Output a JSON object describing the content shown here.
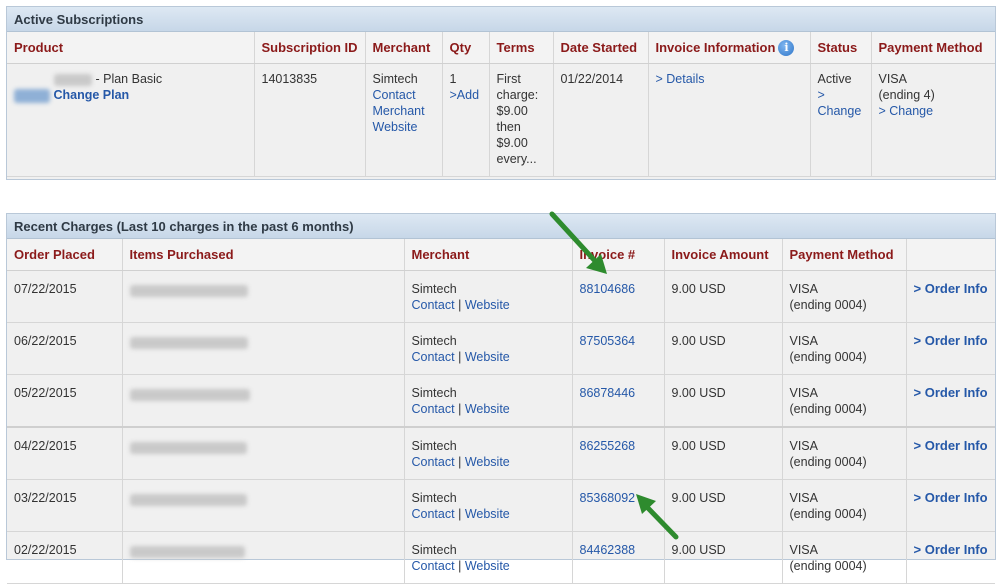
{
  "active": {
    "title": "Active Subscriptions",
    "columns": [
      "Product",
      "Subscription ID",
      "Merchant",
      "Qty",
      "Terms",
      "Date Started",
      "Invoice Information",
      "Status",
      "Payment Method"
    ],
    "row": {
      "product_name": "- Plan Basic",
      "change_plan": "Change Plan",
      "subscription_id": "14013835",
      "merchant": "Simtech",
      "contact_merchant_website": "Contact Merchant Website",
      "qty": "1",
      "qty_add": ">Add",
      "terms": "First charge: $9.00 then $9.00 every...",
      "date_started": "01/22/2014",
      "details": "> Details",
      "status": "Active",
      "status_change": "> Change",
      "payment_card": "VISA",
      "payment_ending": "(ending 4)",
      "payment_change": "> Change"
    },
    "icons": {
      "info": "info-circle-icon"
    }
  },
  "recent": {
    "title": "Recent Charges (Last 10 charges in the past 6 months)",
    "columns": [
      "Order Placed",
      "Items Purchased",
      "Merchant",
      "Invoice #",
      "Invoice Amount",
      "Payment Method",
      ""
    ],
    "contact_label": "Contact",
    "separator": "|",
    "website_label": "Website",
    "order_info_label": "> Order Info",
    "rows": [
      {
        "date": "07/22/2015",
        "merchant": "Simtech",
        "invoice": "88104686",
        "amount": "9.00 USD",
        "card": "VISA",
        "ending": "(ending 0004)"
      },
      {
        "date": "06/22/2015",
        "merchant": "Simtech",
        "invoice": "87505364",
        "amount": "9.00 USD",
        "card": "VISA",
        "ending": "(ending 0004)"
      },
      {
        "date": "05/22/2015",
        "merchant": "Simtech",
        "invoice": "86878446",
        "amount": "9.00 USD",
        "card": "VISA",
        "ending": "(ending 0004)"
      },
      {
        "date": "04/22/2015",
        "merchant": "Simtech",
        "invoice": "86255268",
        "amount": "9.00 USD",
        "card": "VISA",
        "ending": "(ending 0004)"
      },
      {
        "date": "03/22/2015",
        "merchant": "Simtech",
        "invoice": "85368092",
        "amount": "9.00 USD",
        "card": "VISA",
        "ending": "(ending 0004)"
      },
      {
        "date": "02/22/2015",
        "merchant": "Simtech",
        "invoice": "84462388",
        "amount": "9.00 USD",
        "card": "VISA",
        "ending": "(ending 0004)"
      }
    ]
  },
  "colors": {
    "header_text": "#8b1a1a",
    "link": "#2558a8",
    "arrow": "#2e8b2e"
  }
}
